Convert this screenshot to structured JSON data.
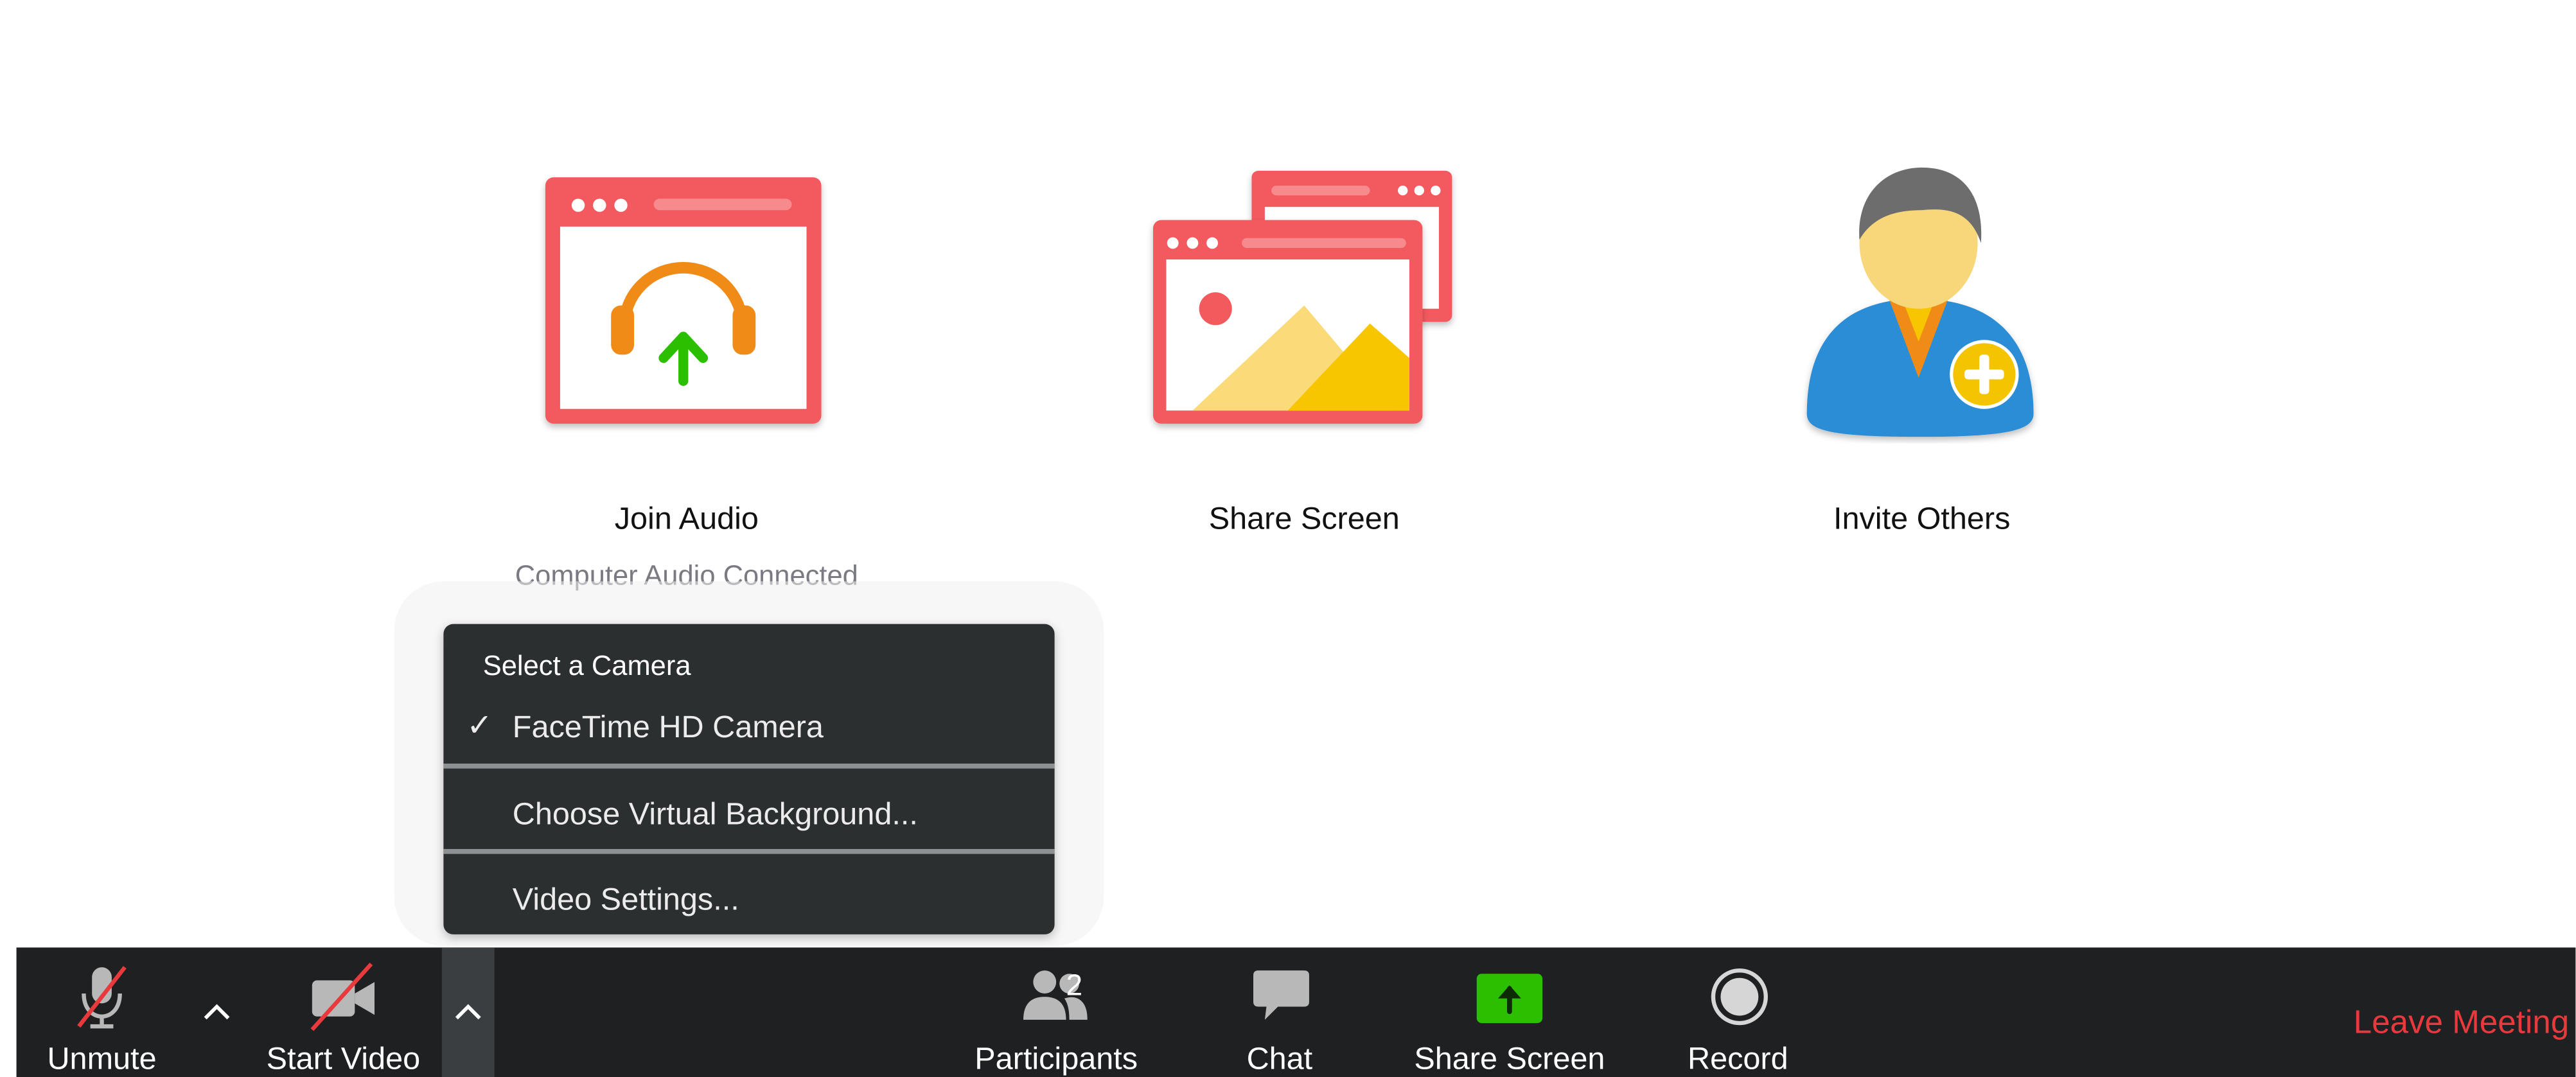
{
  "actions": {
    "join_audio": {
      "label": "Join Audio",
      "status": "Computer Audio Connected",
      "icon": "headphones-window-icon"
    },
    "share_screen": {
      "label": "Share Screen",
      "icon": "share-screen-windows-icon"
    },
    "invite_others": {
      "label": "Invite Others",
      "icon": "add-person-icon"
    }
  },
  "camera_menu": {
    "header": "Select a Camera",
    "check_mark": "✓",
    "items": [
      {
        "label": "FaceTime HD Camera",
        "checked": true
      },
      {
        "label": "Choose Virtual Background..."
      },
      {
        "label": "Video Settings..."
      }
    ]
  },
  "toolbar": {
    "unmute_label": "Unmute",
    "start_video_label": "Start Video",
    "participants_label": "Participants",
    "participants_count": "2",
    "chat_label": "Chat",
    "share_screen_label": "Share Screen",
    "record_label": "Record",
    "leave_label": "Leave Meeting"
  },
  "colors": {
    "accent_red": "#f25a5e",
    "share_green": "#2bbf00",
    "leave_red": "#e8393c",
    "toolbar_bg": "#1e2022",
    "menu_bg": "#2c2f30",
    "headphone_orange": "#ef8b16",
    "person_blue": "#2b8dd6",
    "plus_yellow": "#f5c400"
  }
}
